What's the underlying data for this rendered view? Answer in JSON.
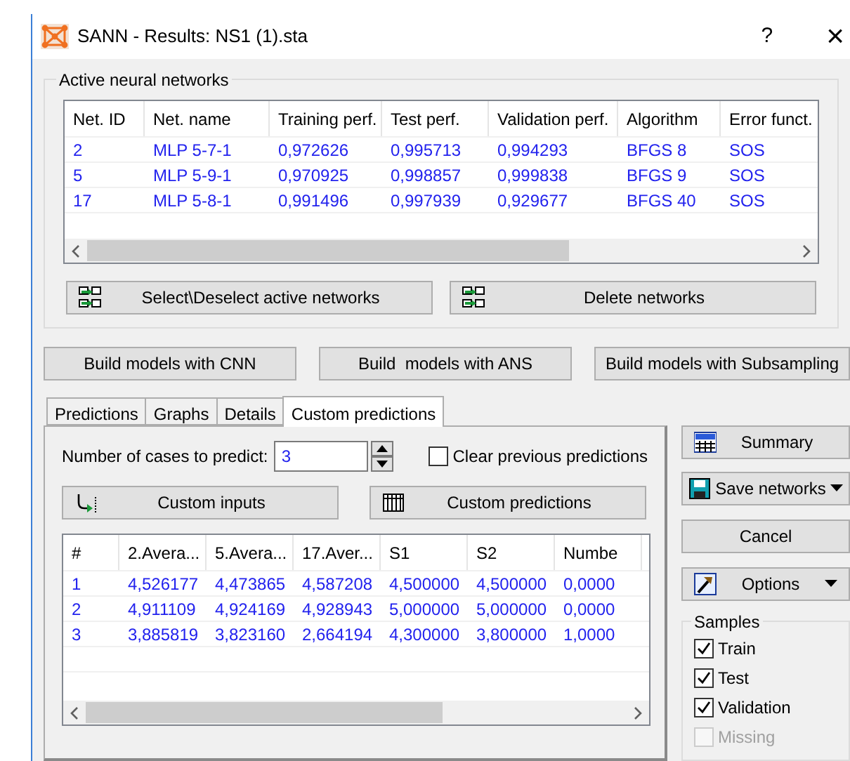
{
  "window": {
    "title": "SANN - Results: NS1 (1).sta",
    "help": "?",
    "close": "×"
  },
  "active_networks": {
    "label": "Active neural networks",
    "columns": [
      "Net. ID",
      "Net. name",
      "Training perf.",
      "Test perf.",
      "Validation perf.",
      "Algorithm",
      "Error funct."
    ],
    "rows": [
      [
        "2",
        "MLP 5-7-1",
        "0,972626",
        "0,995713",
        "0,994293",
        "BFGS 8",
        "SOS"
      ],
      [
        "5",
        "MLP 5-9-1",
        "0,970925",
        "0,998857",
        "0,999838",
        "BFGS 9",
        "SOS"
      ],
      [
        "17",
        "MLP 5-8-1",
        "0,991496",
        "0,997939",
        "0,929677",
        "BFGS 40",
        "SOS"
      ]
    ],
    "buttons": [
      "Select\\Deselect active networks",
      "Delete networks"
    ]
  },
  "build_buttons": [
    "Build models with CNN",
    "Build  models with ANS",
    "Build models with Subsampling"
  ],
  "tabs": [
    {
      "label": "Predictions",
      "selected": false
    },
    {
      "label": "Graphs",
      "selected": false
    },
    {
      "label": "Details",
      "selected": false
    },
    {
      "label": "Custom predictions",
      "selected": true
    }
  ],
  "custom": {
    "cases_label": "Number of cases to predict:",
    "cases_value": "3",
    "clear_previous": {
      "label": "Clear previous predictions",
      "checked": false
    },
    "buttons": [
      "Custom inputs",
      "Custom predictions"
    ],
    "columns": [
      "#",
      "2.Avera...",
      "5.Avera...",
      "17.Aver...",
      "S1",
      "S2",
      "Numbe"
    ],
    "rows": [
      [
        "1",
        "4,526177",
        "4,473865",
        "4,587208",
        "4,500000",
        "4,500000",
        "0,0000"
      ],
      [
        "2",
        "4,911109",
        "4,924169",
        "4,928943",
        "5,000000",
        "5,000000",
        "0,0000"
      ],
      [
        "3",
        "3,885819",
        "3,823160",
        "2,664194",
        "4,300000",
        "3,800000",
        "1,0000"
      ]
    ]
  },
  "side": {
    "summary": "Summary",
    "save": "Save networks",
    "cancel": "Cancel",
    "options": "Options",
    "samples": {
      "label": "Samples",
      "items": [
        {
          "label": "Train",
          "checked": true,
          "disabled": false
        },
        {
          "label": "Test",
          "checked": true,
          "disabled": false
        },
        {
          "label": "Validation",
          "checked": true,
          "disabled": false
        },
        {
          "label": "Missing",
          "checked": false,
          "disabled": true
        }
      ]
    }
  }
}
